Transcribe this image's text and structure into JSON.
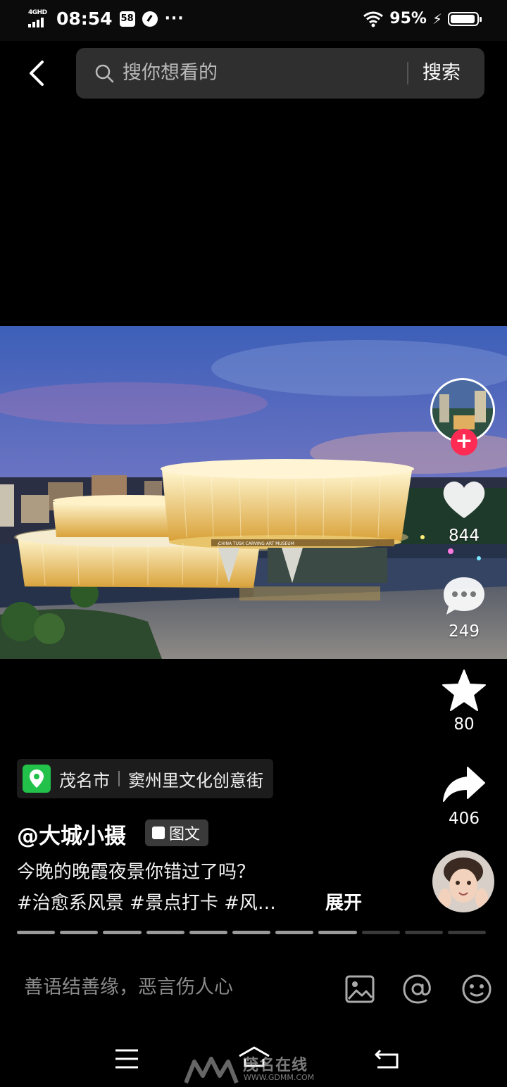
{
  "status_bar": {
    "network": "4GHD",
    "time": "08:54",
    "badge": "58",
    "more": "···",
    "battery_percent": "95%",
    "battery_level": 0.95
  },
  "search": {
    "placeholder": "搜你想看的",
    "button_label": "搜索"
  },
  "rail": {
    "like_count": "844",
    "comment_count": "249",
    "favorite_count": "80",
    "share_count": "406",
    "follow_symbol": "+"
  },
  "location": {
    "city": "茂名市",
    "place": "窦州里文化创意街"
  },
  "post": {
    "author": "@大城小摄",
    "type_tag": "图文",
    "caption_line1": "今晚的晚霞夜景你错过了吗？",
    "caption_line2": "#治愈系风景 #景点打卡 #风…",
    "expand_label": "展开",
    "image_sign_text": "CHINA TUSK CARVING ART MUSEUM",
    "progress": {
      "total": 11,
      "active": 8
    }
  },
  "comment_bar": {
    "placeholder": "善语结善缘，恶言伤人心"
  },
  "watermark": {
    "text": "茂名在线",
    "url": "WWW.GDMM.COM"
  },
  "colors": {
    "follow_red": "#fe2c55",
    "location_green": "#21c14a"
  }
}
